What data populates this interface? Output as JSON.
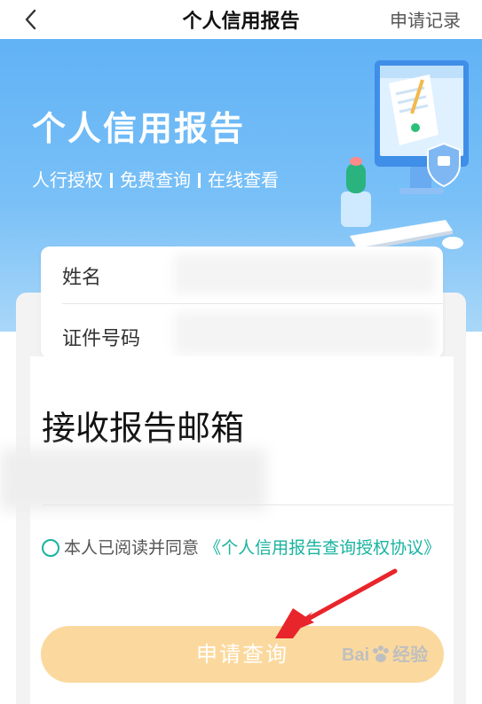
{
  "header": {
    "title": "个人信用报告",
    "records_label": "申请记录"
  },
  "hero": {
    "title": "个人信用报告",
    "features": [
      "人行授权",
      "免费查询",
      "在线查看"
    ]
  },
  "form": {
    "name_label": "姓名",
    "id_label": "证件号码",
    "email_label": "接收报告邮箱"
  },
  "agreement": {
    "prefix": "本人已阅读并同意",
    "link": "《个人信用报告查询授权协议》"
  },
  "submit": {
    "label": "申请查询"
  },
  "watermark": {
    "brand": "Bai",
    "suffix": "经验"
  },
  "colors": {
    "hero_top": "#61b2f6",
    "accent": "#19b3a0",
    "button": "#fbd99e",
    "arrow": "#e8252b"
  }
}
